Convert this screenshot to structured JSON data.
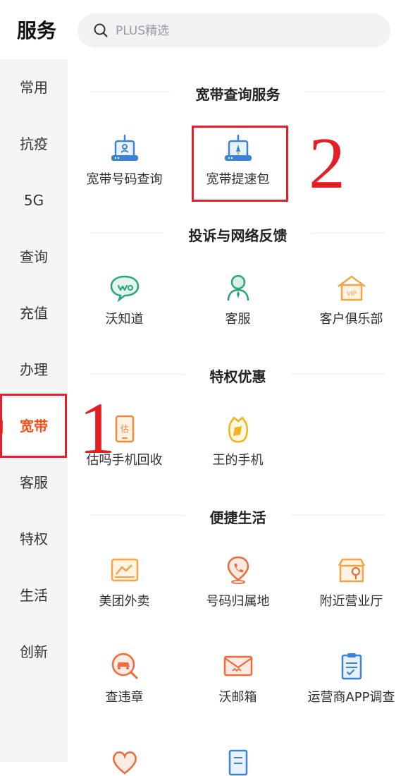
{
  "header": {
    "title": "服务",
    "search_placeholder": "PLUS精选"
  },
  "sidebar": {
    "items": [
      {
        "label": "常用"
      },
      {
        "label": "抗疫"
      },
      {
        "label": "5G"
      },
      {
        "label": "查询"
      },
      {
        "label": "充值"
      },
      {
        "label": "办理"
      },
      {
        "label": "宽带",
        "active": true
      },
      {
        "label": "客服"
      },
      {
        "label": "特权"
      },
      {
        "label": "生活"
      },
      {
        "label": "创新"
      }
    ]
  },
  "sections": [
    {
      "title": "宽带查询服务",
      "items": [
        {
          "label": "宽带号码查询",
          "icon": "broadband-id-icon"
        },
        {
          "label": "宽带提速包",
          "icon": "rocket-modem-icon"
        }
      ]
    },
    {
      "title": "投诉与网络反馈",
      "items": [
        {
          "label": "沃知道",
          "icon": "chat-bubble-icon"
        },
        {
          "label": "客服",
          "icon": "agent-icon"
        },
        {
          "label": "客户俱乐部",
          "icon": "vip-house-icon"
        }
      ]
    },
    {
      "title": "特权优惠",
      "items": [
        {
          "label": "估吗手机回收",
          "icon": "phone-estimate-icon"
        },
        {
          "label": "王的手机",
          "icon": "crown-phone-icon"
        }
      ]
    },
    {
      "title": "便捷生活",
      "items": [
        {
          "label": "美团外卖",
          "icon": "delivery-icon"
        },
        {
          "label": "号码归属地",
          "icon": "location-phone-icon"
        },
        {
          "label": "附近营业厅",
          "icon": "nearby-store-icon"
        },
        {
          "label": "查违章",
          "icon": "car-search-icon"
        },
        {
          "label": "沃邮箱",
          "icon": "mail-icon"
        },
        {
          "label": "运营商APP调查",
          "icon": "survey-clipboard-icon"
        }
      ]
    }
  ],
  "annotations": {
    "one": "1",
    "two": "2"
  },
  "colors": {
    "accent": "#f5521b",
    "annotation": "#e51e24",
    "icon_blue": "#3b83d6",
    "icon_orange": "#f4a347"
  }
}
